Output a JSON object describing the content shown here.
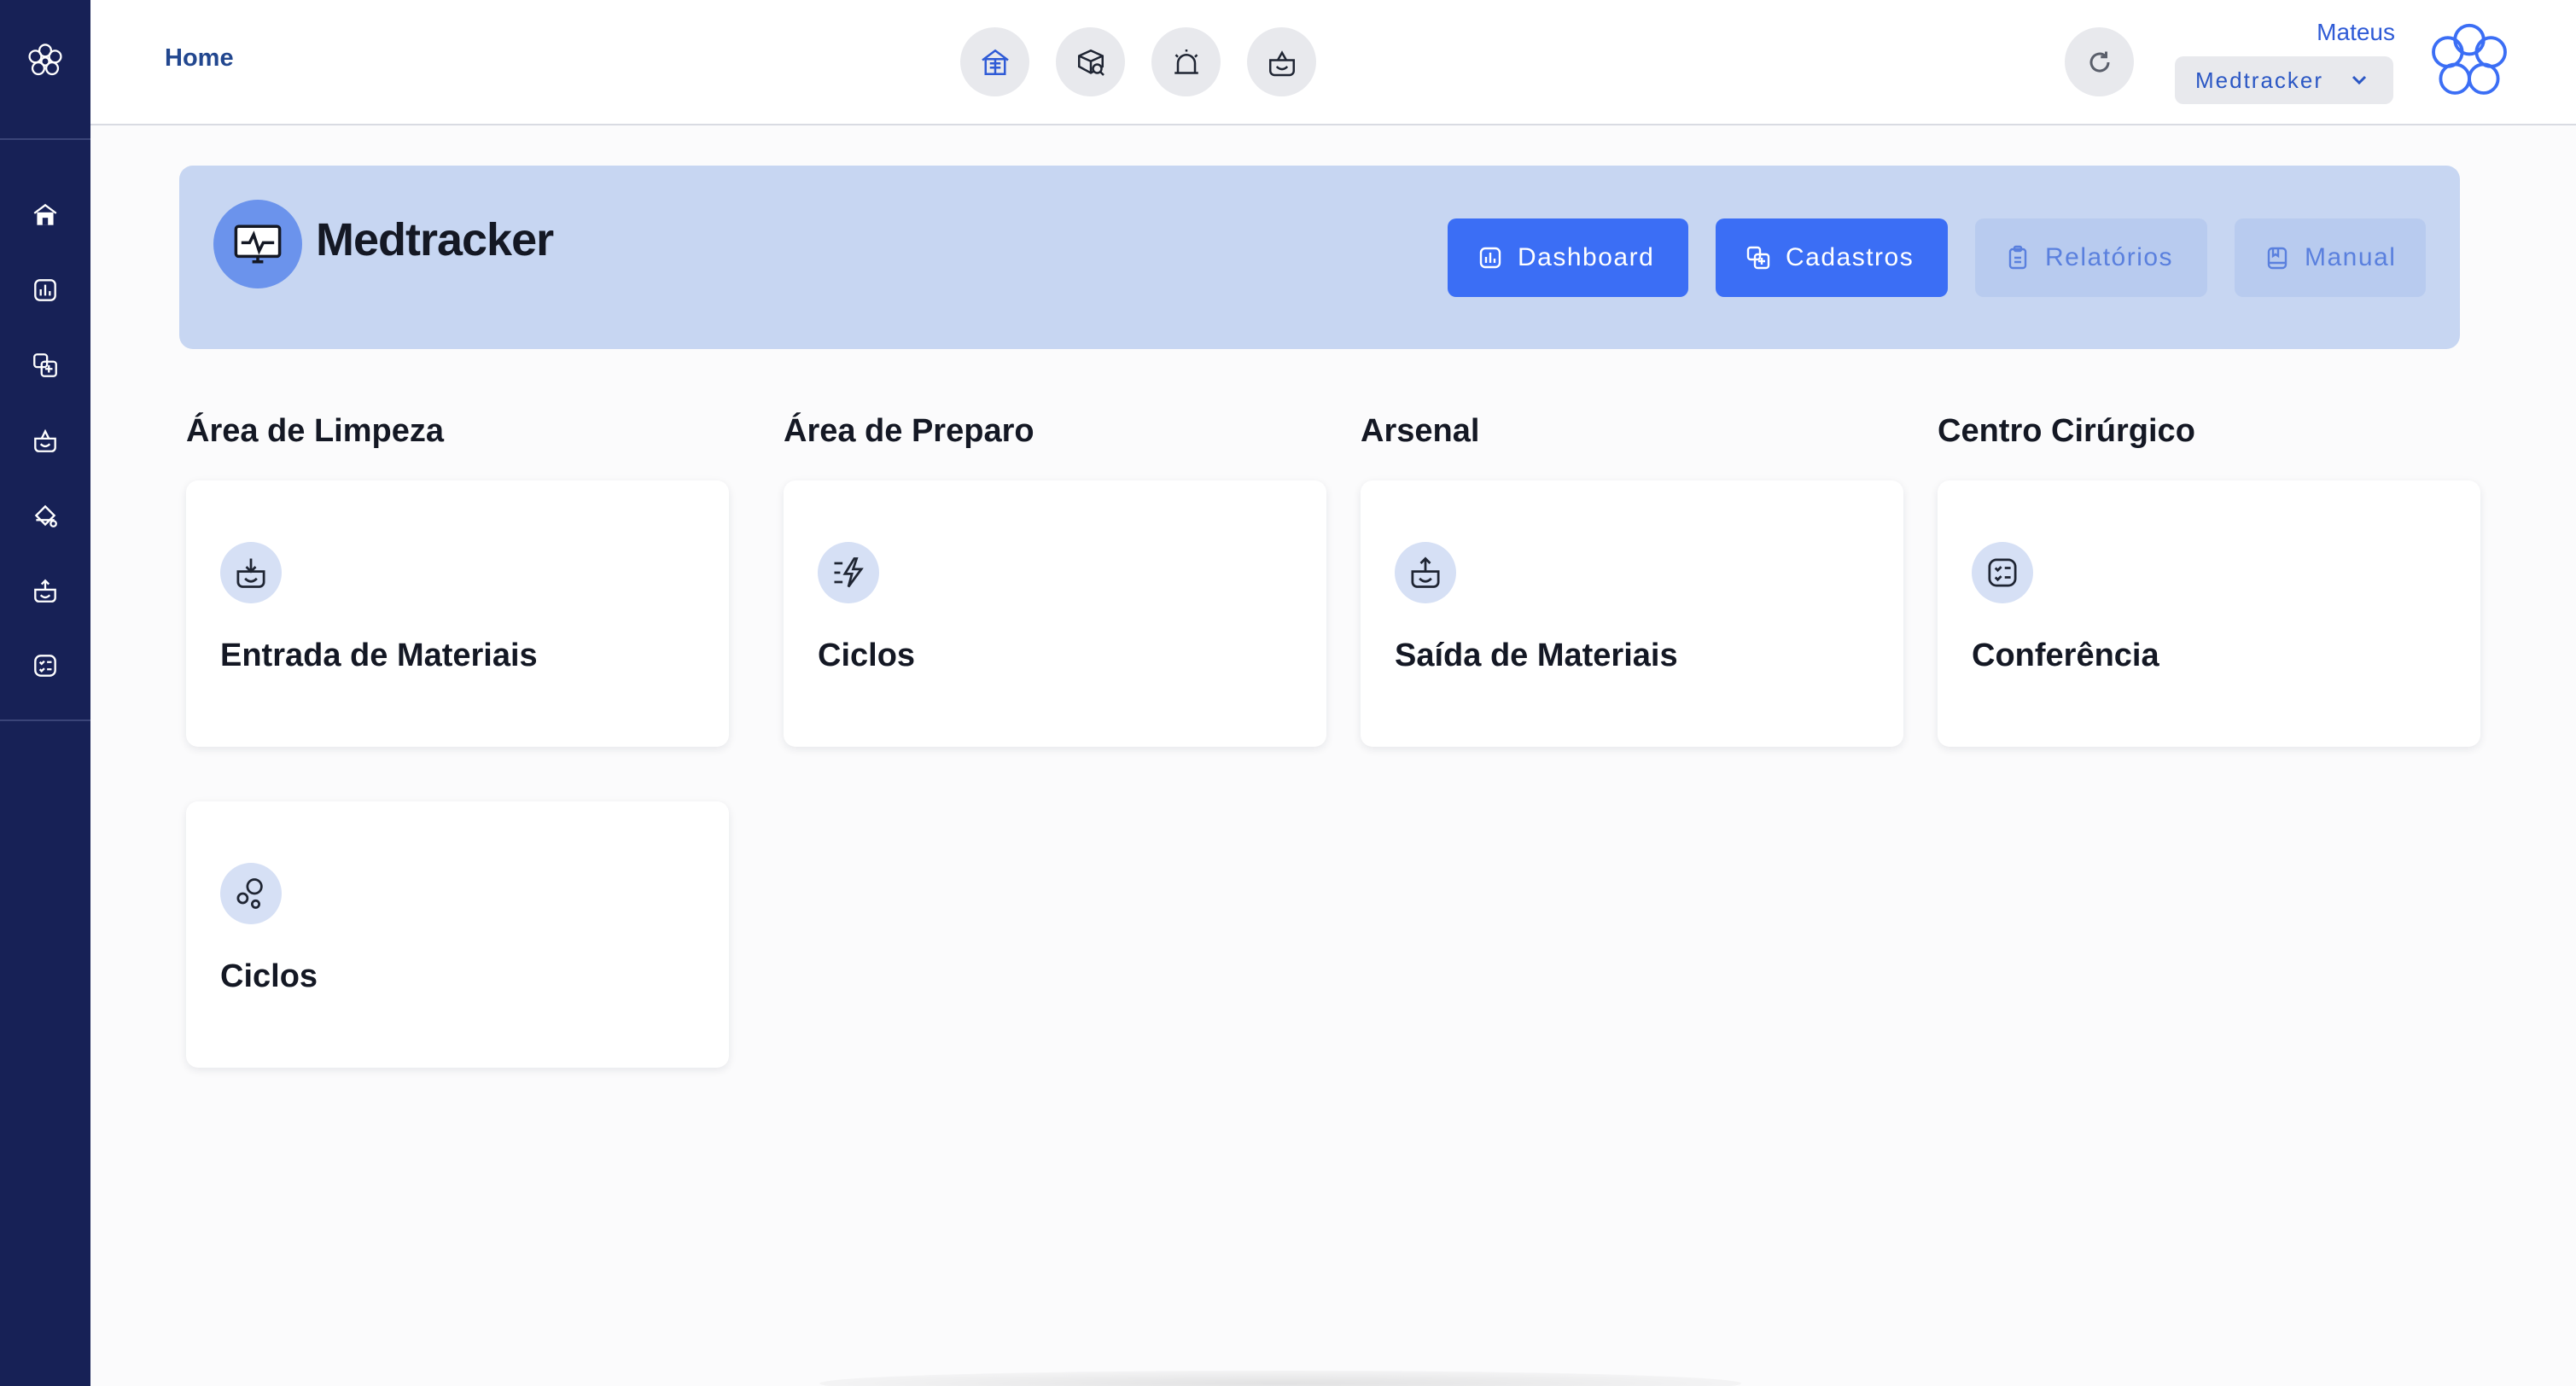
{
  "sidebar": {
    "logo_icon": "flower-logo-icon",
    "items": [
      {
        "icon": "home-icon"
      },
      {
        "icon": "chart-icon"
      },
      {
        "icon": "cadastros-icon"
      },
      {
        "icon": "basket-icon"
      },
      {
        "icon": "spray-icon"
      },
      {
        "icon": "tray-upload-icon"
      },
      {
        "icon": "checklist-icon"
      }
    ]
  },
  "header": {
    "breadcrumb": "Home",
    "quick_buttons": [
      "home-icon",
      "box-search-icon",
      "alarm-icon",
      "tray-icon"
    ],
    "refresh_icon": "refresh-icon",
    "user_name": "Mateus",
    "org_select": "Medtracker",
    "avatar_icon": "flower-logo-icon"
  },
  "banner": {
    "app_icon": "monitor-pulse-icon",
    "title": "Medtracker",
    "buttons": [
      {
        "label": "Dashboard",
        "icon": "chart-icon",
        "style": "primary"
      },
      {
        "label": "Cadastros",
        "icon": "cadastros-icon",
        "style": "primary"
      },
      {
        "label": "Relatórios",
        "icon": "clipboard-icon",
        "style": "secondary"
      },
      {
        "label": "Manual",
        "icon": "book-icon",
        "style": "secondary"
      }
    ]
  },
  "sections": [
    {
      "title": "Área de Limpeza",
      "cards": [
        {
          "label": "Entrada de Materiais",
          "icon": "tray-download-icon"
        },
        {
          "label": "Ciclos",
          "icon": "bubbles-icon"
        }
      ]
    },
    {
      "title": "Área de Preparo",
      "cards": [
        {
          "label": "Ciclos",
          "icon": "lightning-lines-icon"
        }
      ]
    },
    {
      "title": "Arsenal",
      "cards": [
        {
          "label": "Saída de Materiais",
          "icon": "tray-upload-icon"
        }
      ]
    },
    {
      "title": "Centro Cirúrgico",
      "cards": [
        {
          "label": "Conferência",
          "icon": "checklist-icon"
        }
      ]
    }
  ],
  "colors": {
    "sidebar_bg": "#172156",
    "primary": "#3b6ef5",
    "banner_bg": "#c7d6f2",
    "secondary_btn_bg": "#b8cbef",
    "card_icon_bg": "#d6e0f5",
    "text_dark": "#141824"
  }
}
